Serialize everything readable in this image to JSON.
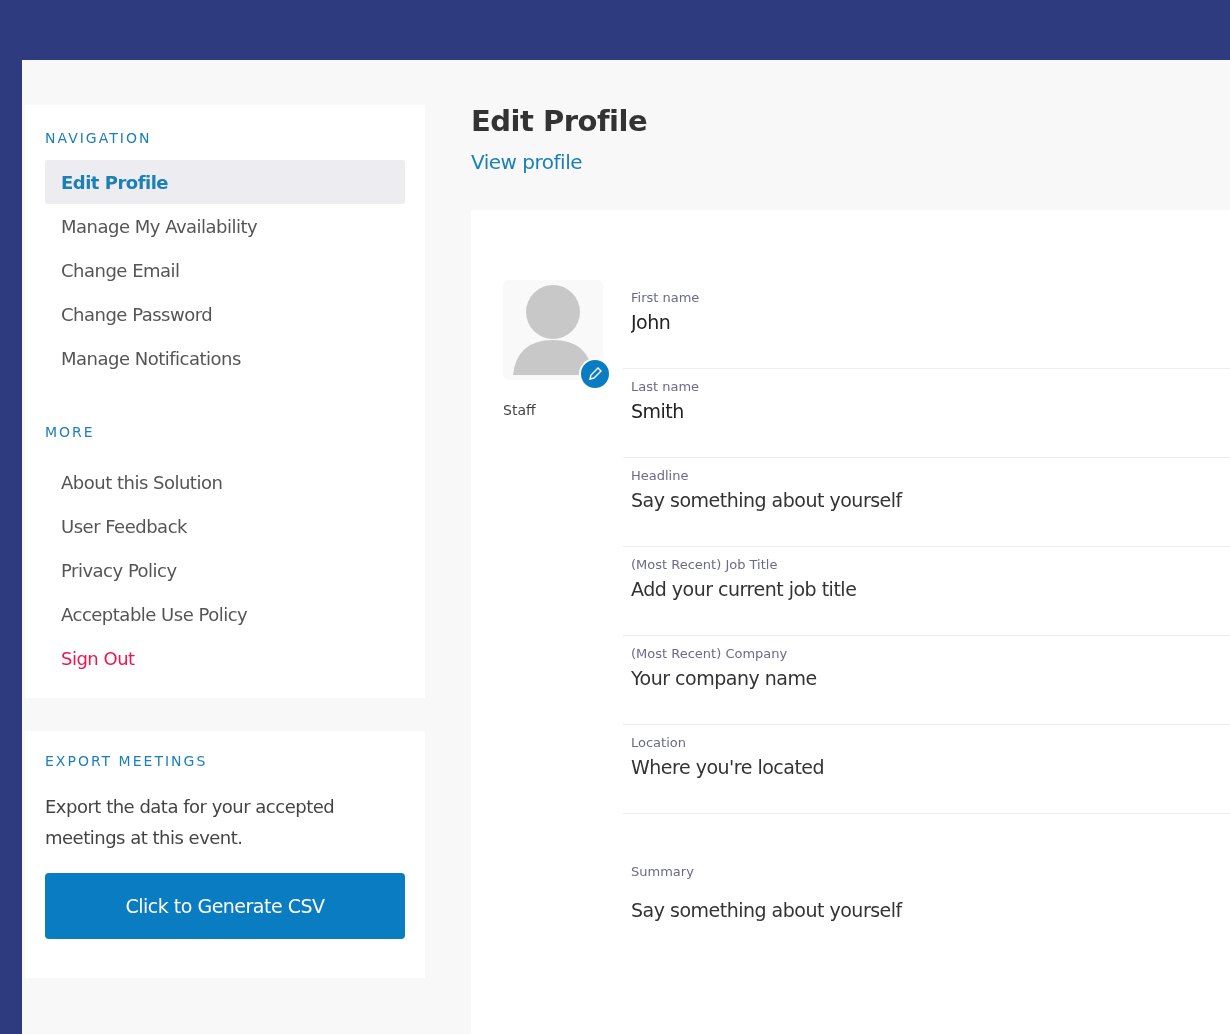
{
  "sidebar": {
    "sections": [
      {
        "heading": "NAVIGATION",
        "items": [
          {
            "label": "Edit Profile",
            "selected": true,
            "kind": "link"
          },
          {
            "label": "Manage My Availability",
            "selected": false,
            "kind": "link"
          },
          {
            "label": "Change Email",
            "selected": false,
            "kind": "link"
          },
          {
            "label": "Change Password",
            "selected": false,
            "kind": "link"
          },
          {
            "label": "Manage Notifications",
            "selected": false,
            "kind": "link"
          }
        ]
      },
      {
        "heading": "MORE",
        "items": [
          {
            "label": "About this Solution",
            "selected": false,
            "kind": "link"
          },
          {
            "label": "User Feedback",
            "selected": false,
            "kind": "link"
          },
          {
            "label": "Privacy Policy",
            "selected": false,
            "kind": "link"
          },
          {
            "label": "Acceptable Use Policy",
            "selected": false,
            "kind": "link"
          },
          {
            "label": "Sign Out",
            "selected": false,
            "kind": "danger"
          }
        ]
      }
    ]
  },
  "export": {
    "heading": "EXPORT MEETINGS",
    "text": "Export the data for your accepted meetings at this event.",
    "button": "Click to Generate CSV"
  },
  "page": {
    "title": "Edit Profile",
    "link": "View profile"
  },
  "avatar": {
    "caption": "Staff"
  },
  "fields": [
    {
      "label": "First name",
      "value": "John"
    },
    {
      "label": "Last name",
      "value": "Smith"
    },
    {
      "label": "Headline",
      "placeholder": "Say something about yourself"
    },
    {
      "label": "(Most Recent) Job Title",
      "placeholder": "Add your current job title"
    },
    {
      "label": "(Most Recent) Company",
      "placeholder": "Your company name"
    },
    {
      "label": "Location",
      "placeholder": "Where you're located"
    },
    {
      "label": "Summary",
      "placeholder": "Say something about yourself",
      "kind": "textarea"
    }
  ]
}
